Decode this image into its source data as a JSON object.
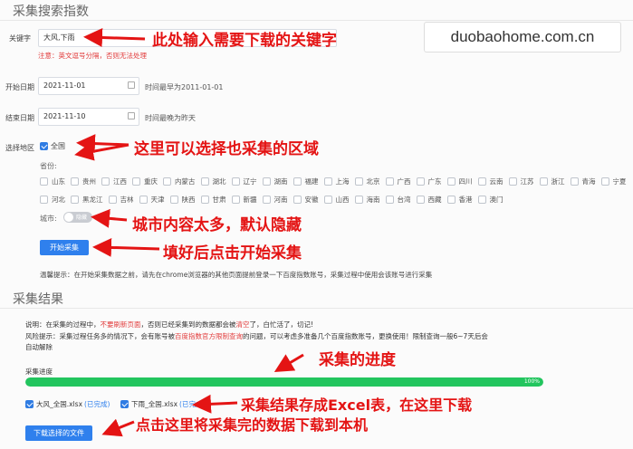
{
  "collect": {
    "section_title": "采集搜索指数",
    "keyword_label": "关键字",
    "keyword_value": "大风,下雨",
    "keyword_warning": "注意：英文逗号分隔，否则无法处理",
    "start_label": "开始日期",
    "start_value": "2021-11-01",
    "start_hint": "时间最早为2011-01-01",
    "end_label": "结束日期",
    "end_value": "2021-11-10",
    "end_hint": "时间最晚为昨天",
    "region_label": "选择地区",
    "all_label": "全国",
    "province_label": "省份:",
    "provinces_row1": [
      "山东",
      "贵州",
      "江西",
      "重庆",
      "内蒙古",
      "湖北",
      "辽宁",
      "湖南",
      "福建",
      "上海",
      "北京",
      "广西",
      "广东",
      "四川",
      "云南",
      "江苏",
      "浙江",
      "青海",
      "宁夏"
    ],
    "provinces_row2": [
      "河北",
      "黑龙江",
      "吉林",
      "天津",
      "陕西",
      "甘肃",
      "新疆",
      "河南",
      "安徽",
      "山西",
      "海南",
      "台湾",
      "西藏",
      "香港",
      "澳门"
    ],
    "city_label": "城市:",
    "city_toggle": "隐藏",
    "start_button": "开始采集",
    "tip": "温馨提示：在开始采集数据之前，请先在chrome浏览器的其他页面提前登录一下百度指数账号，采集过程中使用会该账号进行采集"
  },
  "result": {
    "section_title": "采集结果",
    "note1_a": "说明：在采集的过程中，",
    "note1_b": "不要刷新页面",
    "note1_c": "，否则已经采集到的数据都会被",
    "note1_d": "清空",
    "note1_e": "了，白忙活了，切记!",
    "note2_a": "风险提示：采集过程任务多的情况下，会有账号被",
    "note2_b": "百度指数官方限制查询",
    "note2_c": "的问题，可以考虑多准备几个百度指数账号，更换使用！限制查询一般6~7天后会",
    "note2_d": "自动解除",
    "progress_label": "采集进度",
    "progress_percent_text": "100%",
    "progress_value": 1.0,
    "file1_name": "大风_全国.xlsx",
    "file1_status": "(已完成)",
    "file2_name": "下雨_全国.xlsx",
    "file2_status": "(已完成)",
    "download_button": "下载选择的文件"
  },
  "watermark": "duobaohome.com.cn",
  "annotations": {
    "a1": "此处输入需要下载的关键字",
    "a2": "这里可以选择也采集的区域",
    "a3": "城市内容太多，默认隐藏",
    "a4": "填好后点击开始采集",
    "a5": "采集的进度",
    "a6": "采集结果存成Excel表，在这里下载",
    "a7": "点击这里将采集完的数据下载到本机"
  },
  "colors": {
    "accent": "#2f80ed",
    "progress": "#22c55e",
    "annotation": "#e41414",
    "warning": "#e23c3c"
  }
}
